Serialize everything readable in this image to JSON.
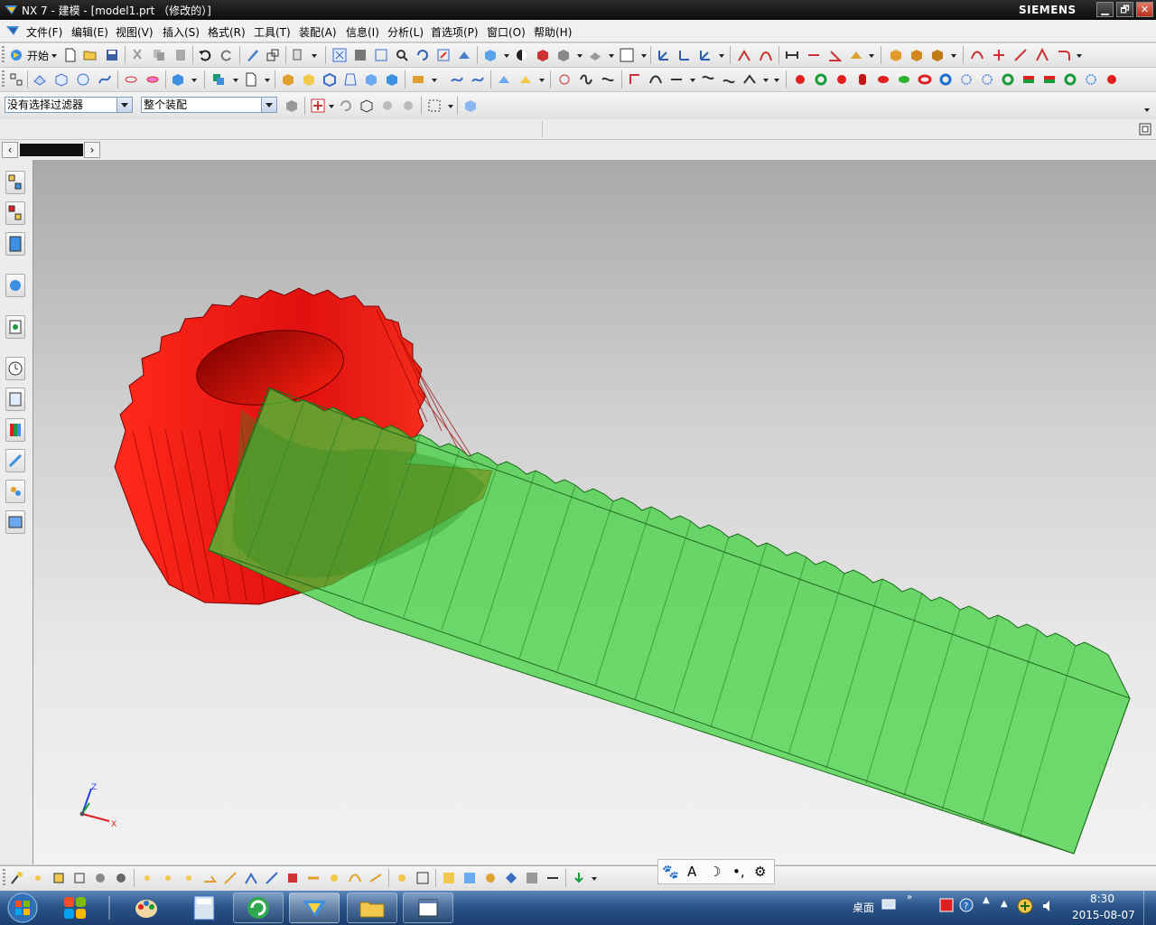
{
  "window": {
    "title": "NX 7 - 建模 - [model1.prt （修改的）]",
    "brand": "SIEMENS",
    "min": "▁",
    "max": "🗗",
    "close": "✕"
  },
  "menu": {
    "items": [
      "文件(F)",
      "编辑(E)",
      "视图(V)",
      "插入(S)",
      "格式(R)",
      "工具(T)",
      "装配(A)",
      "信息(I)",
      "分析(L)",
      "首选项(P)",
      "窗口(O)",
      "帮助(H)"
    ]
  },
  "toolbar1": {
    "start_label": "开始"
  },
  "selection_bar": {
    "filter_value": "没有选择过滤器",
    "scope_value": "整个装配"
  },
  "ime": {
    "items": [
      "🐾",
      "A",
      "☽",
      "•,",
      "⚙"
    ]
  },
  "taskbar": {
    "desktop_label": "桌面",
    "time": "8:30",
    "date": "2015-08-07"
  },
  "triad": {
    "z_label": "Z",
    "x_label": "X"
  },
  "colors": {
    "gear": "#ff1a10",
    "rack": "#4ccd3f",
    "accent": "#2a5488"
  },
  "icons": {
    "app": "nx-logo-icon",
    "start": "start-orb-icon"
  }
}
